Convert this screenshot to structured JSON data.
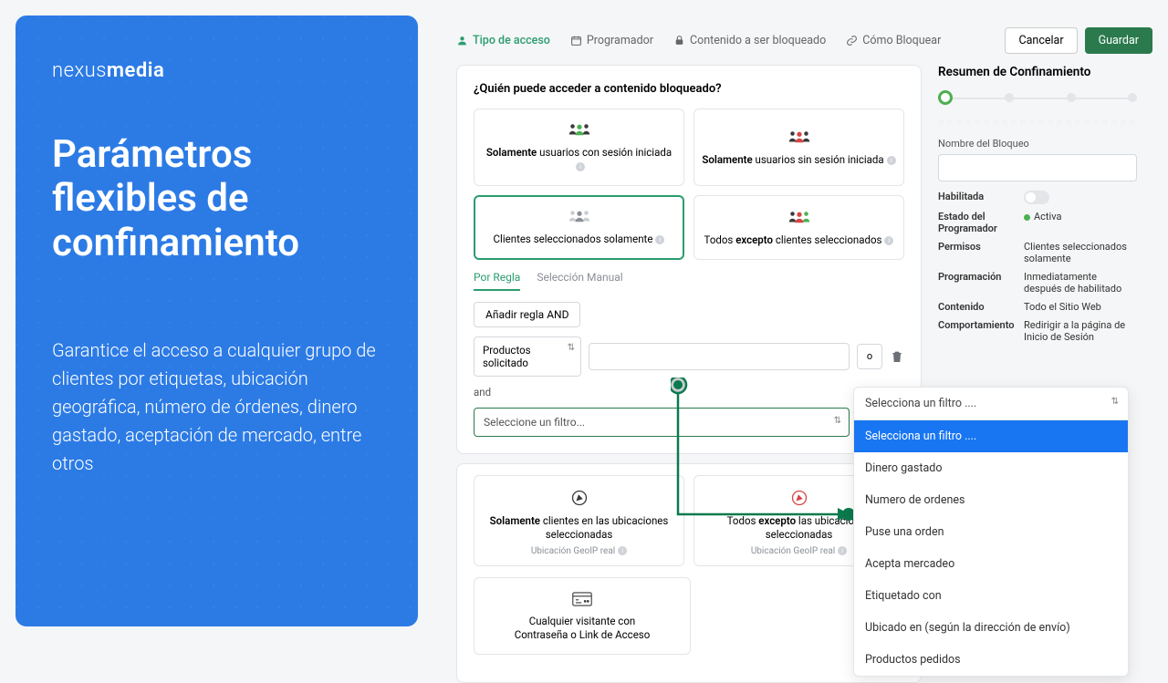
{
  "promo": {
    "logo_light": "nexus",
    "logo_bold": "media",
    "title": "Parámetros flexibles de confinamiento",
    "body": "Garantice el acceso a cualquier grupo de clientes por etiquetas, ubicación geográfica, número de órdenes, dinero gastado, aceptación de mercado, entre otros"
  },
  "tabs": {
    "access": "Tipo de acceso",
    "scheduler": "Programador",
    "content": "Contenido a ser bloqueado",
    "how": "Cómo Bloquear"
  },
  "actions": {
    "cancel": "Cancelar",
    "save": "Guardar"
  },
  "panel": {
    "heading": "¿Quién puede acceder a contenido bloqueado?",
    "card1_pre": "Solamente",
    "card1_rest": " usuarios con sesión iniciada",
    "card2_pre": "Solamente",
    "card2_rest": " usuarios sin sesión iniciada",
    "card3": "Clientes seleccionados solamente",
    "card4_pre": "Todos ",
    "card4_b": "excepto",
    "card4_rest": " clientes seleccionados",
    "subtab1": "Por Regla",
    "subtab2": "Selección Manual",
    "add_rule": "Añadir regla AND",
    "filter1": "Productos solicitado",
    "orbtn": "o",
    "and": "and",
    "filter2_ph": "Seleccione un filtro...",
    "card5_pre": "Solamente",
    "card5_rest": " clientes en las ubicaciones seleccionadas",
    "card6_pre": "Todos ",
    "card6_b": "excepto",
    "card6_rest": " las ubicaciones seleccionadas",
    "geo": "Ubicación GeoIP real",
    "card7a": "Cualquier visitante con",
    "card7b": "Contraseña o Link de Acceso"
  },
  "side": {
    "title": "Resumen de Confinamiento",
    "name_label": "Nombre del Bloqueo",
    "enabled_label": "Habilitada",
    "state_label": "Estado del Programador",
    "state_val": "Activa",
    "perms_label": "Permisos",
    "perms_val": "Clientes seleccionados solamente",
    "sched_label": "Programación",
    "sched_val": "Inmediatamente después de habilitado",
    "content_label": "Contenido",
    "content_val": "Todo el Sitio Web",
    "behav_label": "Comportamiento",
    "behav_val": "Redirigir a la página de Inicio de Sesión"
  },
  "popover": {
    "header": "Selecciona un filtro ....",
    "opts": [
      "Selecciona un filtro ....",
      "Dinero gastado",
      "Numero de ordenes",
      "Puse una orden",
      "Acepta mercadeo",
      "Etiquetado con",
      "Ubicado en (según la dirección de envío)",
      "Productos pedidos"
    ]
  },
  "icons": {
    "info": "i"
  }
}
